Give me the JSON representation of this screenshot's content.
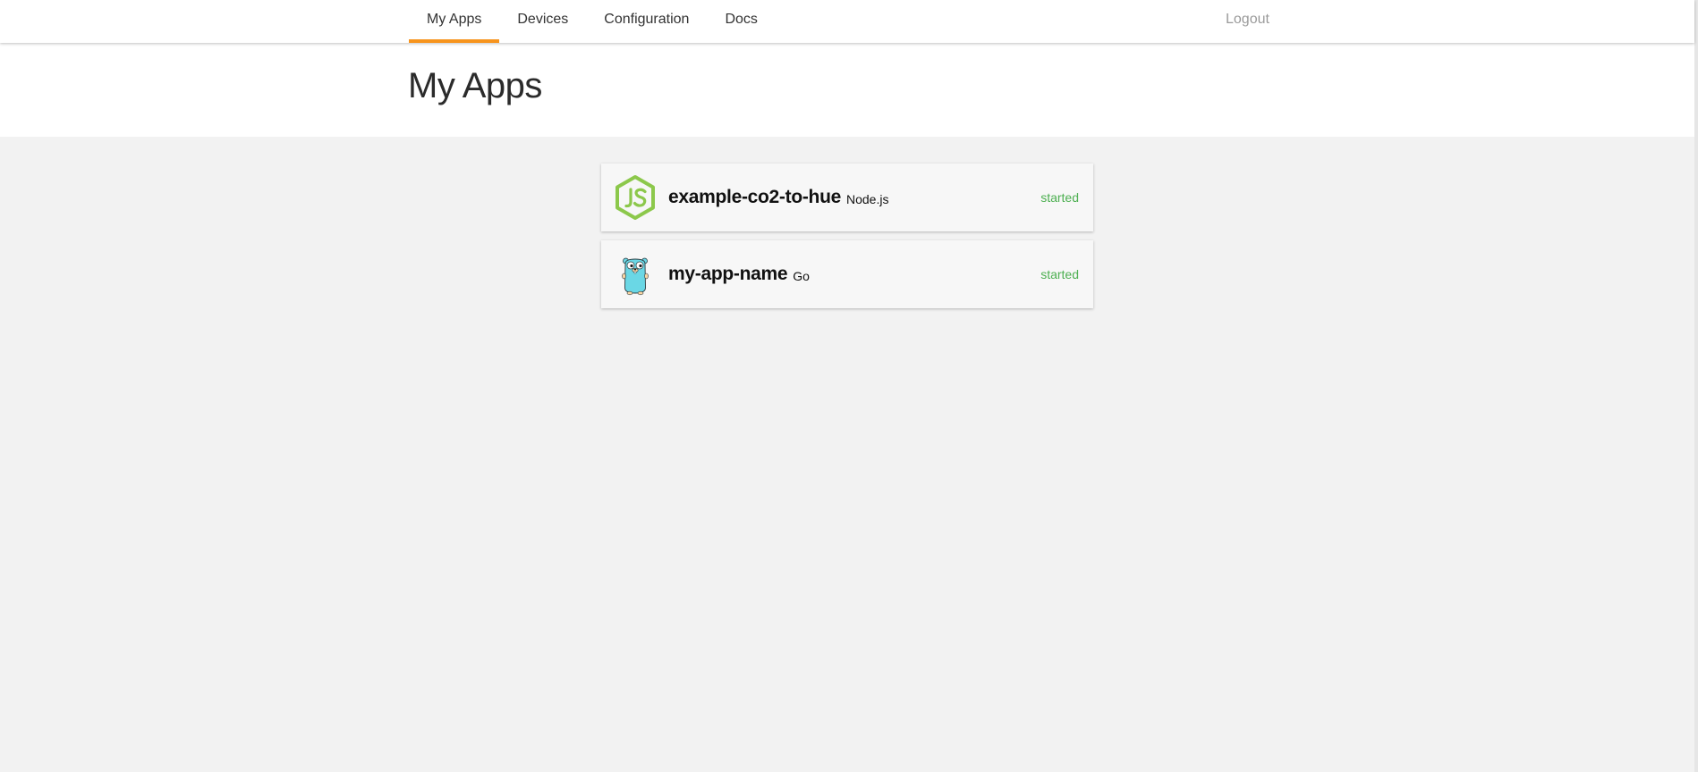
{
  "nav": {
    "items": [
      {
        "label": "My Apps",
        "active": true
      },
      {
        "label": "Devices",
        "active": false
      },
      {
        "label": "Configuration",
        "active": false
      },
      {
        "label": "Docs",
        "active": false
      }
    ],
    "logout_label": "Logout",
    "accent_color": "#f7941d"
  },
  "header": {
    "title": "My Apps"
  },
  "apps": [
    {
      "name": "example-co2-to-hue",
      "runtime": "Node.js",
      "status": "started",
      "icon": "nodejs-icon"
    },
    {
      "name": "my-app-name",
      "runtime": "Go",
      "status": "started",
      "icon": "go-gopher-icon"
    }
  ],
  "colors": {
    "status_started": "#4caf50",
    "nodejs_green": "#8cc84b",
    "gopher_blue": "#6ad7e5"
  }
}
